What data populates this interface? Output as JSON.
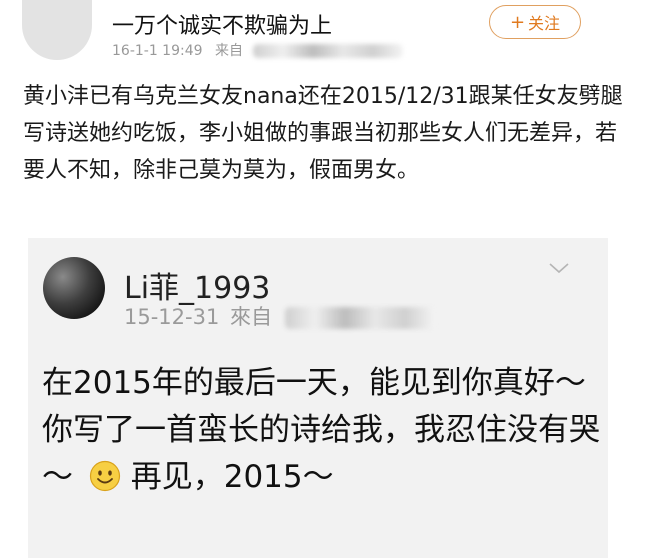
{
  "post": {
    "author": "一万个诚实不欺骗为上",
    "date": "16-1-1 19:49",
    "source_prefix": "来自",
    "follow_label": "关注",
    "body": "黄小沣已有乌克兰女友nana还在2015/12/31跟某任女友劈腿写诗送她约吃饭，李小姐做的事跟当初那些女人们无差异，若要人不知，除非己莫为莫为，假面男女。"
  },
  "quoted": {
    "author": "Li菲_1993",
    "date": "15-12-31",
    "source_prefix": "來自",
    "body_before_emoji": "在2015年的最后一天，能见到你真好～你写了一首蛮长的诗给我，我忍住没有哭～",
    "body_after_emoji": "再见，2015～"
  },
  "icons": {
    "follow": "plus-icon",
    "dropdown": "chevron-down-icon",
    "emoji": "smile-icon"
  },
  "colors": {
    "accent": "#e07a1f",
    "meta_text": "#999999",
    "card_background": "#f2f2f2"
  }
}
